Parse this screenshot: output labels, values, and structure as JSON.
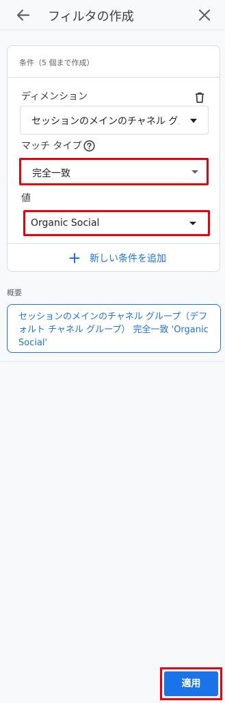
{
  "header": {
    "title": "フィルタの作成",
    "back_icon": "arrow-left-icon",
    "close_icon": "close-icon"
  },
  "condition_card": {
    "heading": "条件（5 個まで作成）",
    "dimension": {
      "label": "ディメンション",
      "value": "セッションのメインのチャネル グループ（デフォルト チャネル グループ）",
      "delete_icon": "trash-icon"
    },
    "match_type": {
      "label": "マッチ タイプ",
      "value": "完全一致",
      "help_icon": "help-circle-icon"
    },
    "value_field": {
      "label": "値",
      "value": "Organic Social"
    },
    "add_condition": {
      "label": "新しい条件を追加",
      "icon": "plus-icon"
    }
  },
  "summary": {
    "label": "概要",
    "text": "セッションのメインのチャネル グループ（デフォルト チャネル グループ） 完全一致 'Organic Social'"
  },
  "footer": {
    "apply_label": "適用"
  },
  "colors": {
    "accent": "#1a73e8",
    "highlight": "#e8000b",
    "background": "#f8f9fa",
    "border": "#dadce0"
  }
}
